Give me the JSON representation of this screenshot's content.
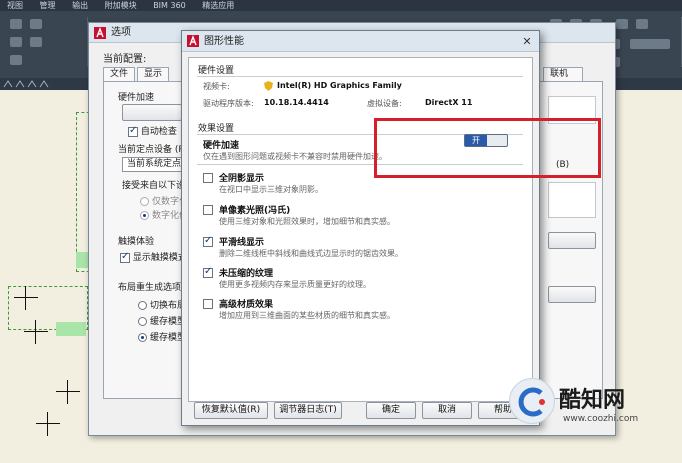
{
  "menubar": {
    "items": [
      "视图",
      "管理",
      "输出",
      "附加模块",
      "BIM 360",
      "精选应用"
    ]
  },
  "options_dialog": {
    "title": "选项",
    "profile_label": "当前配置:",
    "tabs": [
      "文件",
      "显示"
    ],
    "tab_right_partial": "联机",
    "hardware_group": "硬件加速",
    "auto_check_label": "自动检查",
    "pointing_device_label": "当前定点设备 (P",
    "pointing_device_value": "当前系统定点设",
    "accept_input_label": "接受来自以下设",
    "radio_digitizer_only": "仅数字化",
    "radio_digitizer_mouse": "数字化仪",
    "touch_group": "触摸体验",
    "touch_checkbox": "显示触摸模式",
    "layout_regen_group": "布局重生成选项",
    "radio_switch": "切换布局",
    "radio_cache_model": "缓存模型",
    "radio_cache_all": "缓存模型",
    "partial_b": "(B)",
    "hardware_on": true,
    "touch_on": true,
    "radio_layout_selected": 2
  },
  "gp_dialog": {
    "title": "图形性能",
    "close_glyph": "✕",
    "hw_settings_header": "硬件设置",
    "video_card_label": "视频卡:",
    "video_card_value": "Intel(R) HD Graphics Family",
    "driver_label": "驱动程序版本:",
    "driver_value": "10.18.14.4414",
    "virtual_device_label": "虚拟设备:",
    "virtual_device_value": "DirectX 11",
    "effects_header": "效果设置",
    "hw_accel_title": "硬件加速",
    "hw_accel_desc": "仅在遇到图形问题或视频卡不兼容时禁用硬件加速。",
    "toggle_label": "开",
    "toggle_on": true,
    "effects": [
      {
        "title": "全阴影显示",
        "desc": "在视口中显示三维对象阴影。",
        "checked": false
      },
      {
        "title": "单像素光照(冯氏)",
        "desc": "使用三维对象和光照效果时，增加细节和真实感。",
        "checked": false
      },
      {
        "title": "平滑线显示",
        "desc": "删除二维线框中斜线和曲线式边显示时的锯齿效果。",
        "checked": true
      },
      {
        "title": "未压缩的纹理",
        "desc": "使用更多视频内存来显示质量更好的纹理。",
        "checked": true
      },
      {
        "title": "高级材质效果",
        "desc": "增加应用到三维曲面的某些材质的细节和真实感。",
        "checked": false
      }
    ],
    "buttons": {
      "restore": "恢复默认值(R)",
      "log": "调节器日志(T)",
      "ok": "确定",
      "cancel": "取消",
      "help": "帮助"
    }
  },
  "watermark": {
    "brand": "酷知网",
    "url": "www.coozhi.com"
  },
  "colors": {
    "highlight": "#d4202a",
    "toggle_on": "#2a5aa8"
  }
}
